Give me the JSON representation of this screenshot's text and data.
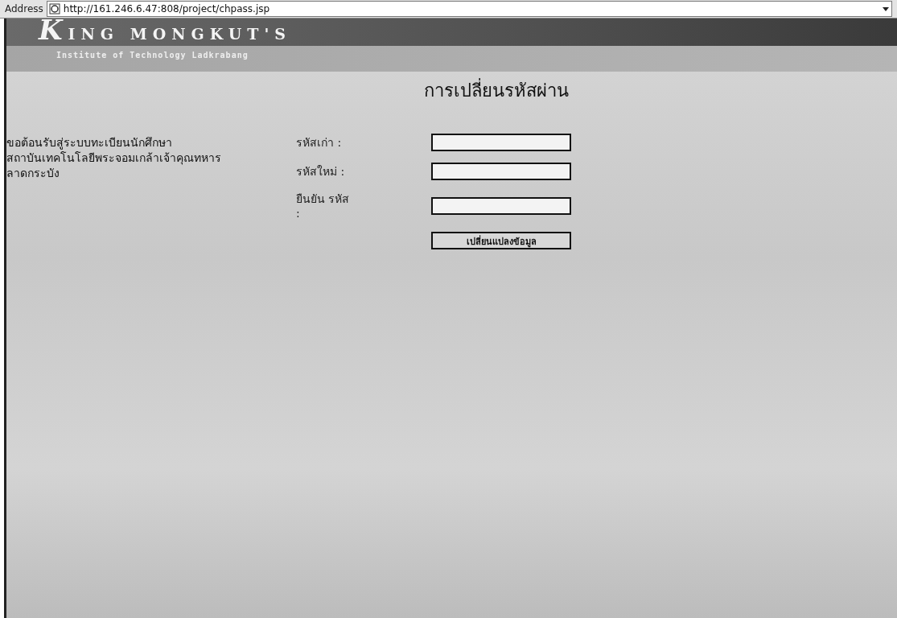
{
  "address_bar": {
    "label": "Address",
    "url": "http://161.246.6.47:808/project/chpass.jsp"
  },
  "banner": {
    "title": "KING MONGKUT'S",
    "subtitle": "Institute of Technology Ladkrabang"
  },
  "page_title": "การเปลี่ยนรหัสผ่าน",
  "welcome_lines": [
    "ขอต้อนรับสู่ระบบทะเบียนนักศึกษา",
    "สถาบันเทคโนโลยีพระจอมเกล้าเจ้าคุณทหาร",
    "ลาดกระบัง"
  ],
  "fields": [
    {
      "label": "รหัสเก่า :"
    },
    {
      "label": "รหัสใหม่ :"
    },
    {
      "label": "ยืนยัน รหัส :"
    }
  ],
  "submit_button": "เปลี่ยนแปลงข้อมูล"
}
